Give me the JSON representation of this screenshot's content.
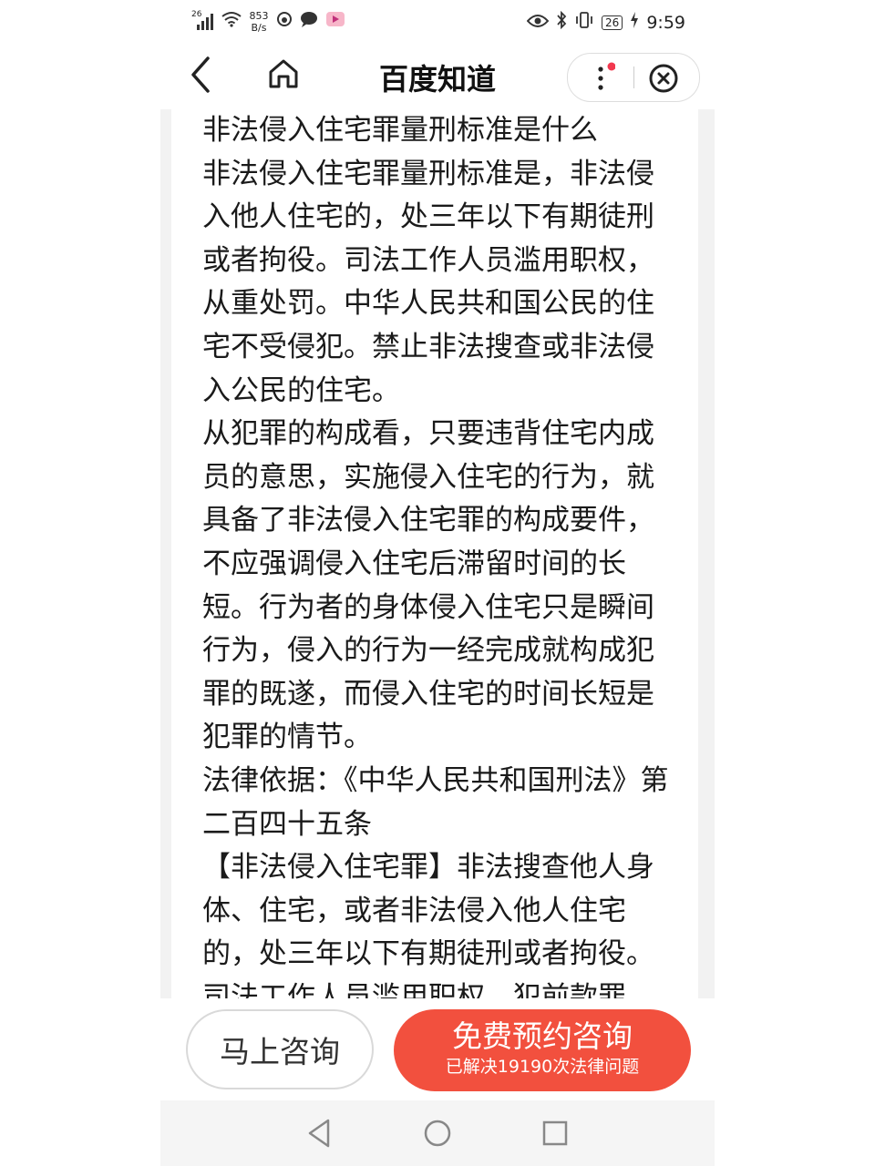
{
  "status_bar": {
    "signal": "26",
    "speed": "853 B/s",
    "battery": "26",
    "time": "9:59"
  },
  "nav": {
    "title": "百度知道"
  },
  "article": {
    "paragraphs": [
      "非法侵入住宅罪量刑标准是什么",
      "非法侵入住宅罪量刑标准是，非法侵入他人住宅的，处三年以下有期徒刑或者拘役。司法工作人员滥用职权，从重处罚。中华人民共和国公民的住宅不受侵犯。禁止非法搜查或非法侵入公民的住宅。",
      "从犯罪的构成看，只要违背住宅内成员的意思，实施侵入住宅的行为，就具备了非法侵入住宅罪的构成要件，不应强调侵入住宅后滞留时间的长短。行为者的身体侵入住宅只是瞬间行为，侵入的行为一经完成就构成犯罪的既遂，而侵入住宅的时间长短是犯罪的情节。",
      "法律依据：《中华人民共和国刑法》第二百四十五条",
      "【非法侵入住宅罪】非法搜查他人身体、住宅，或者非法侵入他人住宅的，处三年以下有期徒刑或者拘役。司法工作人员滥用职权，犯前款罪"
    ]
  },
  "actions": {
    "consult_label": "马上咨询",
    "book_label": "免费预约咨询",
    "book_sub": "已解决19190次法律问题",
    "accent_color": "#f2503e"
  }
}
